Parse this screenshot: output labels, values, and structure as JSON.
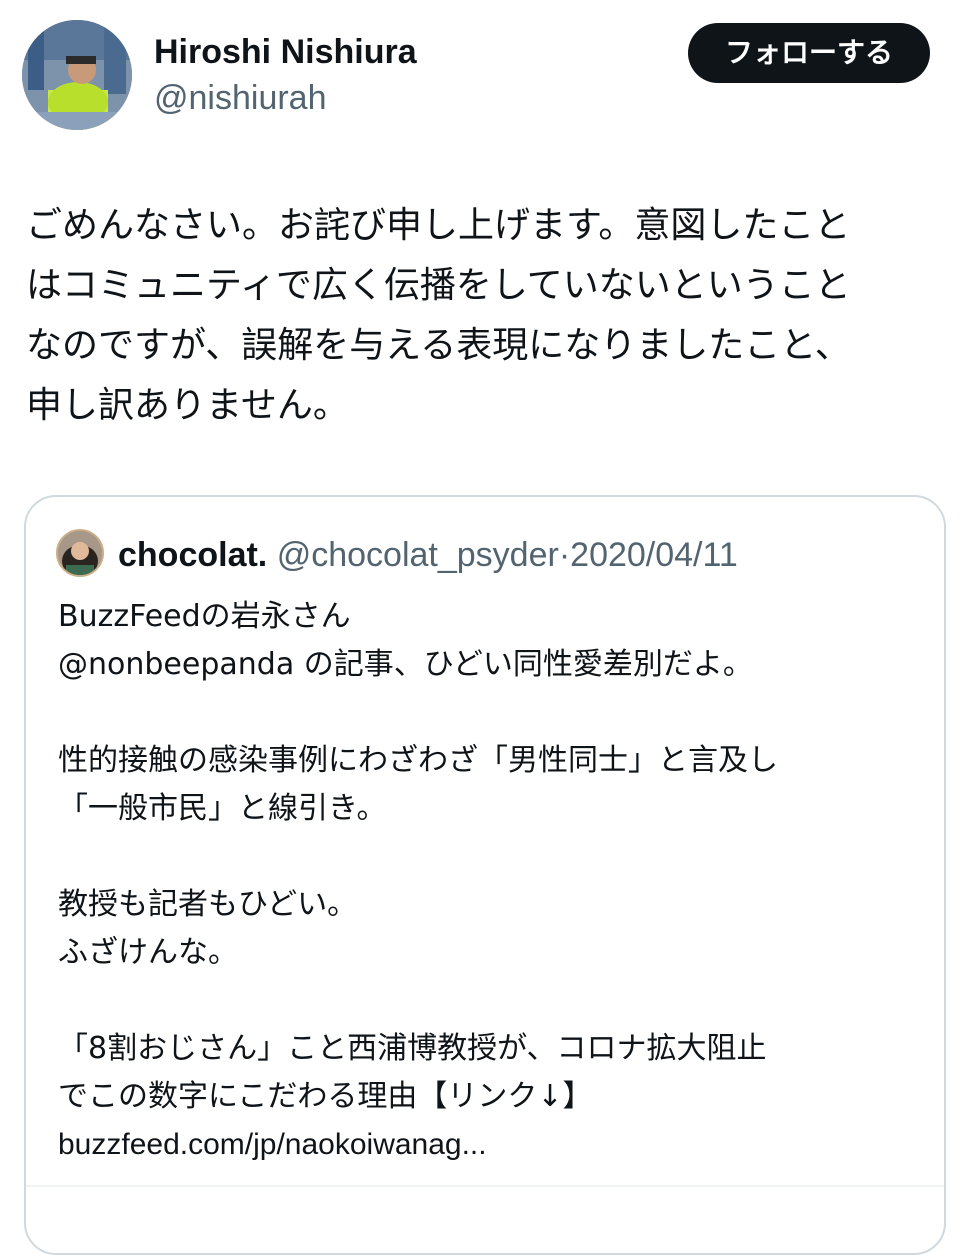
{
  "author": {
    "display_name": "Hiroshi Nishiura",
    "handle": "@nishiurah",
    "follow_label": "フォローする"
  },
  "tweet": {
    "lines": [
      "ごめんなさい。お詫び申し上げます。意図したこと",
      "はコミュニティで広く伝播をしていないということ",
      "なのですが、誤解を与える表現になりましたこと、",
      "申し訳ありません。"
    ]
  },
  "quoted_tweet": {
    "display_name": "chocolat.",
    "handle": "@chocolat_psyder",
    "separator": "·",
    "date": "2020/04/11",
    "lines": [
      "BuzzFeedの岩永さん",
      "@nonbeepanda の記事、ひどい同性愛差別だよ。",
      "",
      "性的接触の感染事例にわざわざ「男性同士」と言及し",
      "「一般市民」と線引き。",
      "",
      "教授も記者もひどい。",
      "ふざけんな。",
      "",
      "「8割おじさん」こと西浦博教授が、コロナ拡大阻止",
      "でこの数字にこだわる理由【リンク↓】",
      "buzzfeed.com/jp/naokoiwanag..."
    ]
  },
  "colors": {
    "text": "#0f1419",
    "secondary": "#536471",
    "button_bg": "#0f1419",
    "border": "#cfd9de"
  }
}
